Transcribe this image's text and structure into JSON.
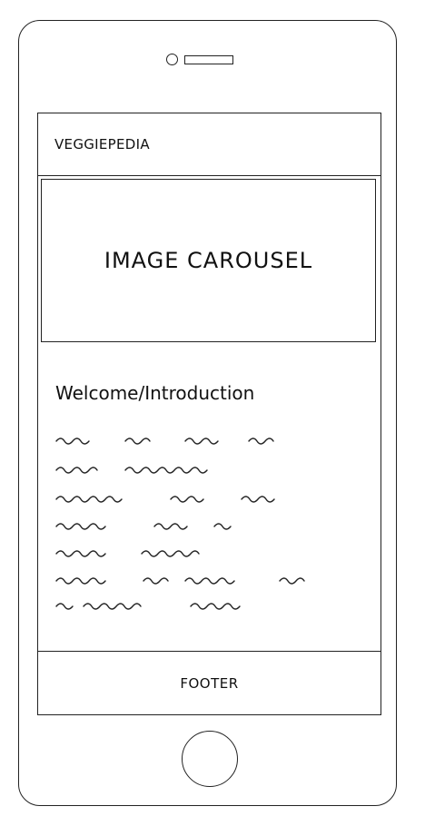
{
  "header": {
    "title": "VEGGIEPEDIA"
  },
  "carousel": {
    "label": "IMAGE CAROUSEL"
  },
  "intro": {
    "heading": "Welcome/Introduction"
  },
  "footer": {
    "label": "FOOTER"
  },
  "icons": {
    "camera": "camera-icon",
    "speaker": "speaker-icon",
    "home": "home-button-icon"
  }
}
